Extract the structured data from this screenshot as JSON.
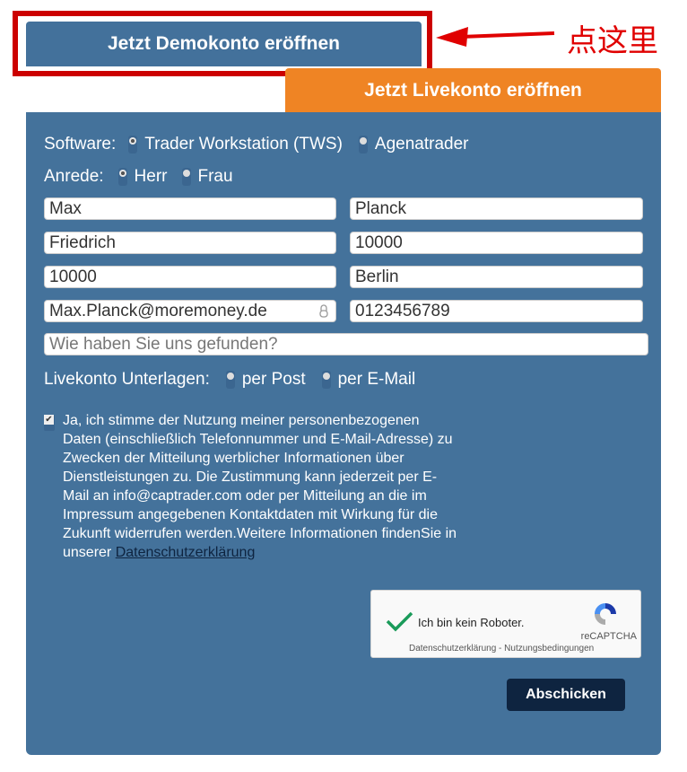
{
  "tabs": {
    "demo": "Jetzt Demokonto eröffnen",
    "live": "Jetzt Livekonto eröffnen"
  },
  "annotation": {
    "text": "点这里",
    "color": "#e00000"
  },
  "form": {
    "software_label": "Software:",
    "software_options": [
      "Trader Workstation (TWS)",
      "Agenatrader"
    ],
    "software_selected": "Trader Workstation (TWS)",
    "salutation_label": "Anrede:",
    "salutation_options": [
      "Herr",
      "Frau"
    ],
    "salutation_selected": "Herr",
    "fields": {
      "first_name": "Max",
      "last_name": "Planck",
      "street": "Friedrich",
      "house_no": "10000",
      "zip": "10000",
      "city": "Berlin",
      "email": "Max.Planck@moremoney.de",
      "phone": "0123456789",
      "source_placeholder": "Wie haben Sie uns gefunden?"
    },
    "docs_label": "Livekonto Unterlagen:",
    "docs_options": [
      "per Post",
      "per E-Mail"
    ],
    "consent_checked": true,
    "consent_text": "Ja, ich stimme der Nutzung meiner personenbezogenen Daten (einschließlich Telefonnummer und E-Mail-Adresse) zu Zwecken der Mitteilung werblicher Informationen über Dienstleistungen zu. Die Zustimmung kann jederzeit per E-Mail an info@captrader.com oder per Mitteilung an die im Impressum angegebenen Kontaktdaten mit Wirkung für die Zukunft widerrufen werden.Weitere Informationen findenSie in unserer ",
    "consent_link": "Datenschutzerklärung",
    "captcha": {
      "label": "Ich bin kein Roboter.",
      "brand": "reCAPTCHA",
      "links": "Datenschutzerklärung - Nutzungsbedingungen",
      "checked": true
    },
    "submit": "Abschicken"
  },
  "colors": {
    "panel": "#44729b",
    "live_tab": "#ef8424",
    "highlight": "#cc0000",
    "submit": "#0e2440"
  }
}
